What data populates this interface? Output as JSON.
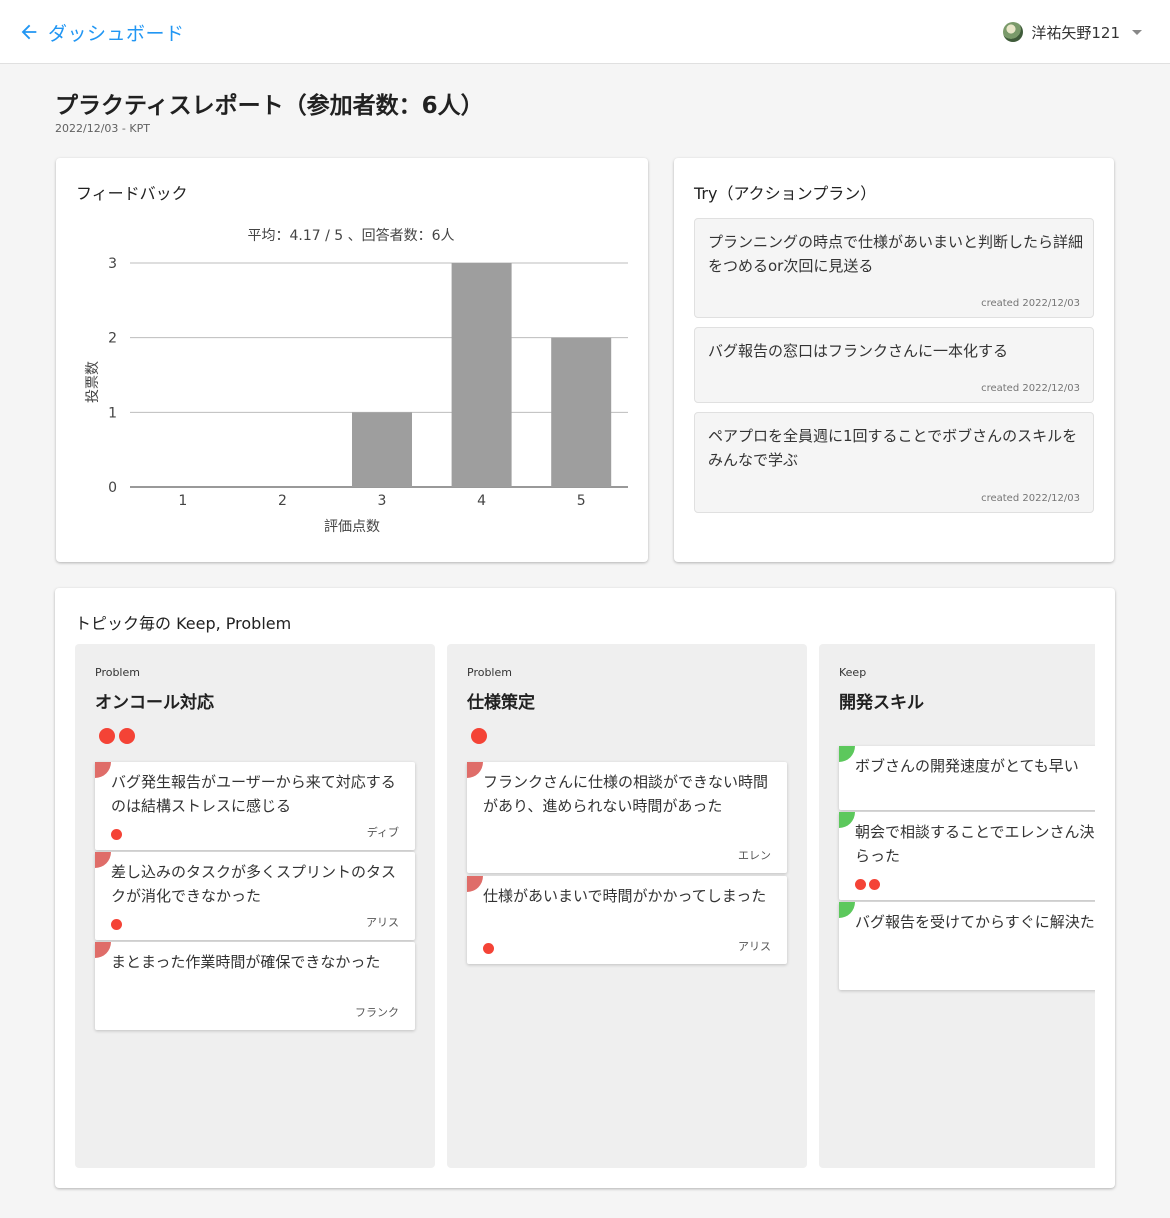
{
  "header": {
    "back_label": "ダッシュボード",
    "user_name": "洋祐矢野121"
  },
  "page": {
    "title": "プラクティスレポート（参加者数：6人）",
    "subtitle": "2022/12/03 - KPT"
  },
  "feedback": {
    "card_title": "フィードバック",
    "chart_data": {
      "type": "bar",
      "title": "平均：4.17 / 5 、回答者数：6人",
      "xlabel": "評価点数",
      "ylabel": "投票数",
      "categories": [
        "1",
        "2",
        "3",
        "4",
        "5"
      ],
      "values": [
        0,
        0,
        1,
        3,
        2
      ],
      "ylim": [
        0,
        3
      ],
      "yticks": [
        "0",
        "1",
        "2",
        "3"
      ],
      "grid": true,
      "bar_color": "#9e9e9e"
    }
  },
  "try": {
    "card_title": "Try（アクションプラン）",
    "items": [
      {
        "text": "プランニングの時点で仕様があいまいと判断したら詳細をつめるor次回に見送る",
        "date": "created 2022/12/03"
      },
      {
        "text": "バグ報告の窓口はフランクさんに一本化する",
        "date": "created 2022/12/03"
      },
      {
        "text": "ペアプロを全員週に1回することでボブさんのスキルをみんなで学ぶ",
        "date": "created 2022/12/03"
      }
    ]
  },
  "topics": {
    "card_title": "トピック毎の Keep, Problem",
    "colors": {
      "problem": "#d9534f",
      "keep": "#5cc85c",
      "vote": "#f44336"
    },
    "columns": [
      {
        "type": "Problem",
        "title": "オンコール対応",
        "items": [
          {
            "text": "バグ発生報告がユーザーから来て対応するのは結構ストレスに感じる",
            "author": "ディブ"
          },
          {
            "text": "差し込みのタスクが多くスプリントのタスクが消化できなかった",
            "author": "アリス"
          },
          {
            "text": "まとまった作業時間が確保できなかった",
            "author": "フランク"
          }
        ]
      },
      {
        "type": "Problem",
        "title": "仕様策定",
        "items": [
          {
            "text": "フランクさんに仕様の相談ができない時間があり、進められない時間があった",
            "author": "エレン"
          },
          {
            "text": "仕様があいまいで時間がかかってしまった",
            "author": "アリス"
          }
        ]
      },
      {
        "type": "Keep",
        "title": "開発スキル",
        "items": [
          {
            "text": "ボブさんの開発速度がとても早い"
          },
          {
            "text": "朝会で相談することでエレンさん決策をもらった"
          },
          {
            "text": "バグ報告を受けてからすぐに解決た"
          }
        ]
      }
    ]
  }
}
